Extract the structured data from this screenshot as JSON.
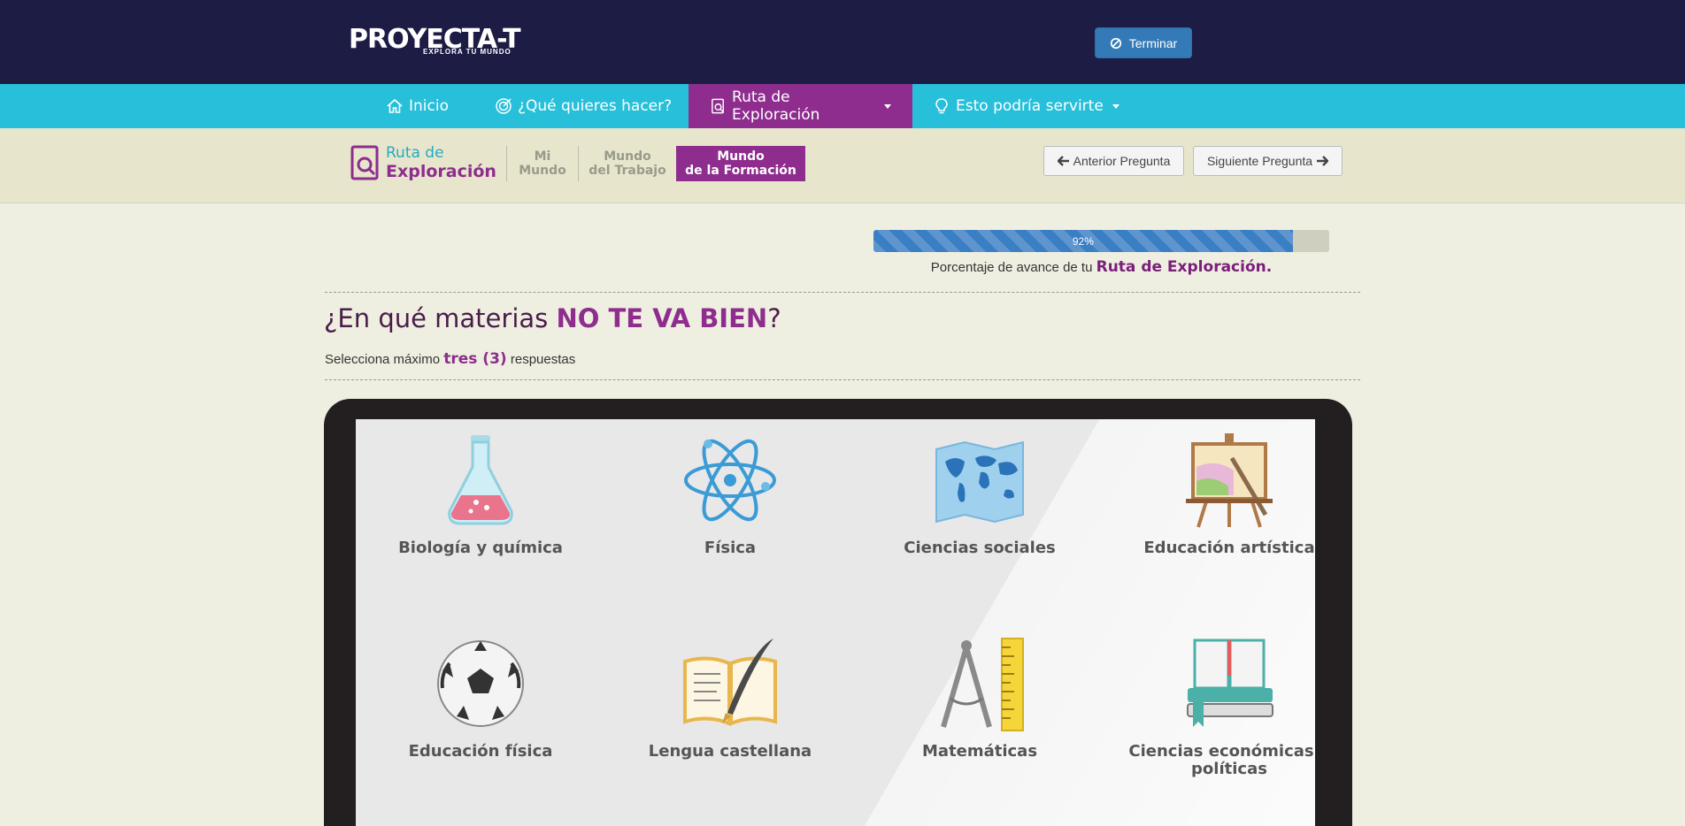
{
  "header": {
    "logo_main": "PROYECTA-T",
    "logo_sub": "EXPLORA TU MUNDO",
    "finish_button": "Terminar"
  },
  "nav": {
    "items": [
      {
        "label": "Inicio",
        "icon": "home-icon"
      },
      {
        "label": "¿Qué quieres hacer?",
        "icon": "target-icon"
      },
      {
        "label": "Ruta de Exploración",
        "icon": "search-document-icon"
      },
      {
        "label": "Esto podría servirte",
        "icon": "lightbulb-icon"
      }
    ],
    "active_index": 2
  },
  "subnav": {
    "logo_line1": "Ruta de",
    "logo_line2": "Exploración",
    "tabs": [
      {
        "line1": "Mi",
        "line2": "Mundo"
      },
      {
        "line1": "Mundo",
        "line2": "del Trabajo"
      },
      {
        "line1": "Mundo",
        "line2": "de la Formación"
      }
    ],
    "active_tab": 2,
    "prev_button": "Anterior Pregunta",
    "next_button": "Siguiente Pregunta"
  },
  "progress": {
    "value": 92,
    "label": "92%",
    "caption_prefix": "Porcentaje de avance de tu",
    "caption_highlight": "Ruta de Exploración."
  },
  "question": {
    "prefix": "¿En qué materias",
    "highlight": "NO TE VA BIEN",
    "suffix": "?",
    "instr_prefix": "Selecciona máximo",
    "instr_highlight": "tres (3)",
    "instr_suffix": "respuestas"
  },
  "subjects": [
    {
      "label": "Biología y química",
      "icon": "flask-icon"
    },
    {
      "label": "Física",
      "icon": "atom-icon"
    },
    {
      "label": "Ciencias sociales",
      "icon": "world-map-icon"
    },
    {
      "label": "Educación artística",
      "icon": "easel-icon"
    },
    {
      "label": "Educación física",
      "icon": "soccer-ball-icon"
    },
    {
      "label": "Lengua castellana",
      "icon": "book-quill-icon"
    },
    {
      "label": "Matemáticas",
      "icon": "compass-ruler-icon"
    },
    {
      "label": "Ciencias económicas y políticas",
      "icon": "books-icon"
    }
  ],
  "colors": {
    "header_bg": "#1c1c44",
    "nav_bg": "#27bfd9",
    "accent_purple": "#8e2d8e",
    "progress_blue": "#3a7ec4",
    "page_bg": "#efefe1"
  }
}
